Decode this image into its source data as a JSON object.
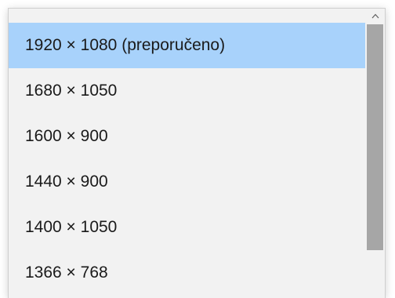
{
  "dropdown": {
    "items": [
      {
        "label": "1920 × 1080 (preporučeno)",
        "selected": true
      },
      {
        "label": "1680 × 1050",
        "selected": false
      },
      {
        "label": "1600 × 900",
        "selected": false
      },
      {
        "label": "1440 × 900",
        "selected": false
      },
      {
        "label": "1400 × 1050",
        "selected": false
      },
      {
        "label": "1366 × 768",
        "selected": false
      }
    ]
  },
  "scrollbar": {
    "up_icon": "chevron-up-icon"
  },
  "colors": {
    "selected_background": "#a8d2fb",
    "list_background": "#f2f2f2",
    "scroll_thumb": "#a6a6a6"
  }
}
